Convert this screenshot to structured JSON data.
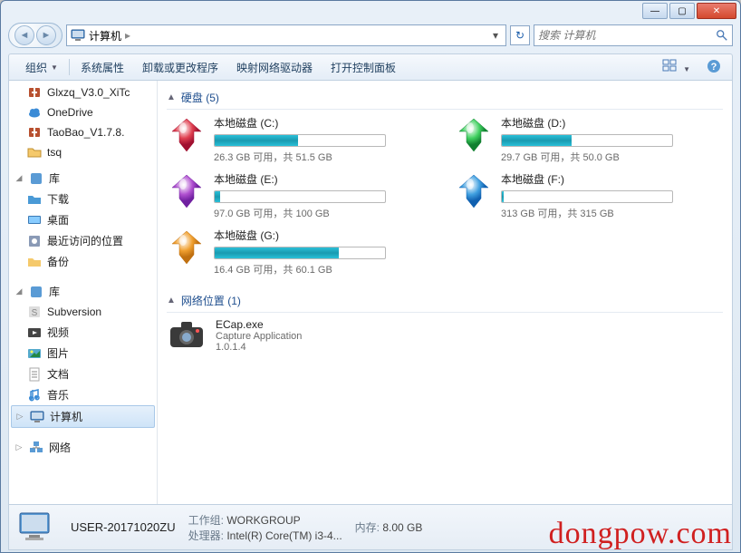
{
  "window": {
    "title": "计算机",
    "min_glyph": "—",
    "max_glyph": "▢",
    "close_glyph": "✕"
  },
  "navbar": {
    "back_glyph": "◄",
    "fwd_glyph": "►",
    "location_root": "计算机",
    "sep_glyph": "▸",
    "drop_glyph": "▾",
    "refresh_glyph": "↻"
  },
  "search": {
    "placeholder": "搜索 计算机"
  },
  "toolbar": {
    "organize": "组织",
    "system_props": "系统属性",
    "uninstall": "卸载或更改程序",
    "map_drive": "映射网络驱动器",
    "control_panel": "打开控制面板",
    "help_glyph": "?"
  },
  "sidebar": {
    "items_top": [
      {
        "label": "Glxzq_V3.0_XiTc",
        "icon": "archive"
      },
      {
        "label": "OneDrive",
        "icon": "cloud"
      },
      {
        "label": "TaoBao_V1.7.8.",
        "icon": "archive"
      },
      {
        "label": "tsq",
        "icon": "folder"
      }
    ],
    "group_lib": {
      "label": "库",
      "tri": "◢"
    },
    "lib_items": [
      {
        "label": "下载"
      },
      {
        "label": "桌面"
      },
      {
        "label": "最近访问的位置"
      },
      {
        "label": "备份"
      }
    ],
    "group_lib2": {
      "label": "库",
      "tri": "◢"
    },
    "lib2_items": [
      {
        "label": "Subversion"
      },
      {
        "label": "视频"
      },
      {
        "label": "图片"
      },
      {
        "label": "文档"
      },
      {
        "label": "音乐"
      }
    ],
    "computer": {
      "label": "计算机",
      "tri": "▷"
    },
    "network": {
      "label": "网络",
      "tri": "▷"
    }
  },
  "content": {
    "section_drives": "硬盘 (5)",
    "drives": [
      {
        "name": "本地磁盘 (C:)",
        "stats": "26.3 GB 可用，共 51.5 GB",
        "pct": 49,
        "color": "red"
      },
      {
        "name": "本地磁盘 (D:)",
        "stats": "29.7 GB 可用，共 50.0 GB",
        "pct": 41,
        "color": "green"
      },
      {
        "name": "本地磁盘 (E:)",
        "stats": "97.0 GB 可用，共 100 GB",
        "pct": 3,
        "color": "purple"
      },
      {
        "name": "本地磁盘 (F:)",
        "stats": "313 GB 可用，共 315 GB",
        "pct": 1,
        "color": "blue"
      },
      {
        "name": "本地磁盘 (G:)",
        "stats": "16.4 GB 可用，共 60.1 GB",
        "pct": 73,
        "color": "orange"
      }
    ],
    "section_netloc": "网络位置 (1)",
    "netloc": {
      "name": "ECap.exe",
      "sub1": "Capture Application",
      "sub2": "1.0.1.4"
    }
  },
  "details": {
    "name": "USER-20171020ZU",
    "workgroup_label": "工作组:",
    "workgroup": "WORKGROUP",
    "memory_label": "内存:",
    "memory": "8.00 GB",
    "processor_label": "处理器:",
    "processor": "Intel(R) Core(TM) i3-4..."
  },
  "watermark": "dongpow.com"
}
